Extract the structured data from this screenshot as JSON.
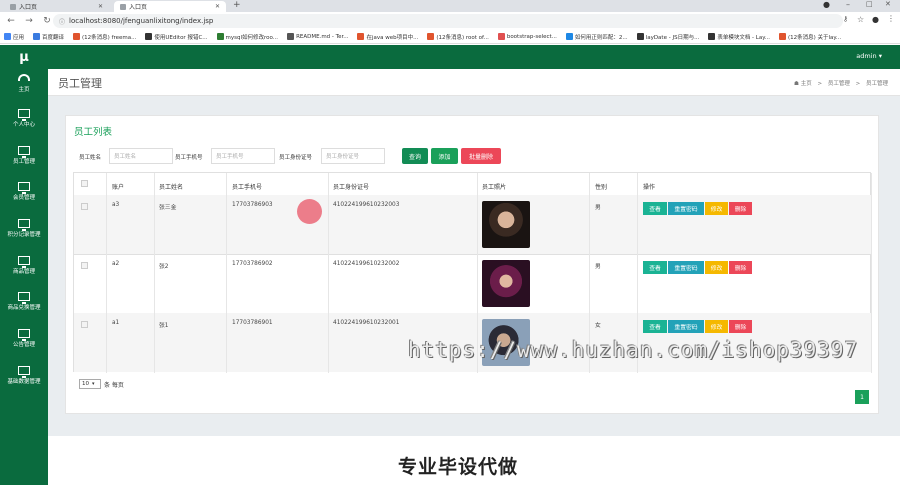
{
  "browser": {
    "tabs": [
      {
        "title": "入口页"
      },
      {
        "title": "入口页"
      }
    ],
    "new_tab": "+",
    "url": "localhost:8080/jfenguanlixitong/index.jsp",
    "bookmarks": [
      {
        "label": "应用",
        "color": "#4285f4"
      },
      {
        "label": "百度翻译",
        "color": "#3a7be0"
      },
      {
        "label": "(12条消息) freema...",
        "color": "#e0542e"
      },
      {
        "label": "使用UEditor 报错C...",
        "color": "#333333"
      },
      {
        "label": "mysql如何修改roo...",
        "color": "#2e7d32"
      },
      {
        "label": "README.md - Ter...",
        "color": "#555555"
      },
      {
        "label": "在java web项目中...",
        "color": "#e0542e"
      },
      {
        "label": "(12条消息) root of...",
        "color": "#e0542e"
      },
      {
        "label": "bootstrap-select...",
        "color": "#e05050"
      },
      {
        "label": "如何用正则匹配：2...",
        "color": "#1e88e5"
      },
      {
        "label": "layDate - JS日期与...",
        "color": "#333333"
      },
      {
        "label": "表单模块文档 - Lay...",
        "color": "#333333"
      },
      {
        "label": "(12条消息) 关于lay...",
        "color": "#e0542e"
      }
    ]
  },
  "app": {
    "logo": "μ",
    "user_menu": "admin ▾",
    "theme_color": "#0a6b3e",
    "accent_green": "#1aa05a"
  },
  "sidebar": {
    "items": [
      {
        "label": "主页",
        "icon": "dashboard-icon"
      },
      {
        "label": "个人中心",
        "icon": "monitor-icon"
      },
      {
        "label": "员工管理",
        "icon": "monitor-icon"
      },
      {
        "label": "会员管理",
        "icon": "monitor-icon"
      },
      {
        "label": "积分记录管理",
        "icon": "monitor-icon"
      },
      {
        "label": "商品管理",
        "icon": "monitor-icon"
      },
      {
        "label": "商品兑换管理",
        "icon": "monitor-icon"
      },
      {
        "label": "公告管理",
        "icon": "monitor-icon"
      },
      {
        "label": "基础数据管理",
        "icon": "monitor-icon"
      }
    ]
  },
  "page": {
    "title": "员工管理",
    "breadcrumb": [
      "主页",
      "员工管理",
      "员工管理"
    ],
    "breadcrumb_sep": ">",
    "panel_title": "员工列表"
  },
  "filters": {
    "name_label": "员工姓名",
    "name_placeholder": "员工姓名",
    "phone_label": "员工手机号",
    "phone_placeholder": "员工手机号",
    "idcard_label": "员工身份证号",
    "idcard_placeholder": "员工身份证号",
    "search_btn": "查询",
    "add_btn": "添加",
    "batch_delete_btn": "批量删除"
  },
  "table": {
    "headers": [
      "账户",
      "员工姓名",
      "员工手机号",
      "员工身份证号",
      "员工照片",
      "性别",
      "操作"
    ],
    "rows": [
      {
        "account": "a3",
        "name": "张三金",
        "phone": "17703786903",
        "idcard": "410224199610232003",
        "gender": "男"
      },
      {
        "account": "a2",
        "name": "张2",
        "phone": "17703786902",
        "idcard": "410224199610232002",
        "gender": "男"
      },
      {
        "account": "a1",
        "name": "张1",
        "phone": "17703786901",
        "idcard": "410224199610232001",
        "gender": "女"
      }
    ],
    "actions": {
      "view": "查看",
      "reset_pwd": "重置密码",
      "edit": "修改",
      "delete": "删除"
    }
  },
  "pagination": {
    "page_size": "10",
    "per_page_label": "条 每页",
    "current_page": "1"
  },
  "overlay": {
    "watermark": "https://www.huzhan.com/ishop39397",
    "bottom_text": "专业毕设代做"
  }
}
